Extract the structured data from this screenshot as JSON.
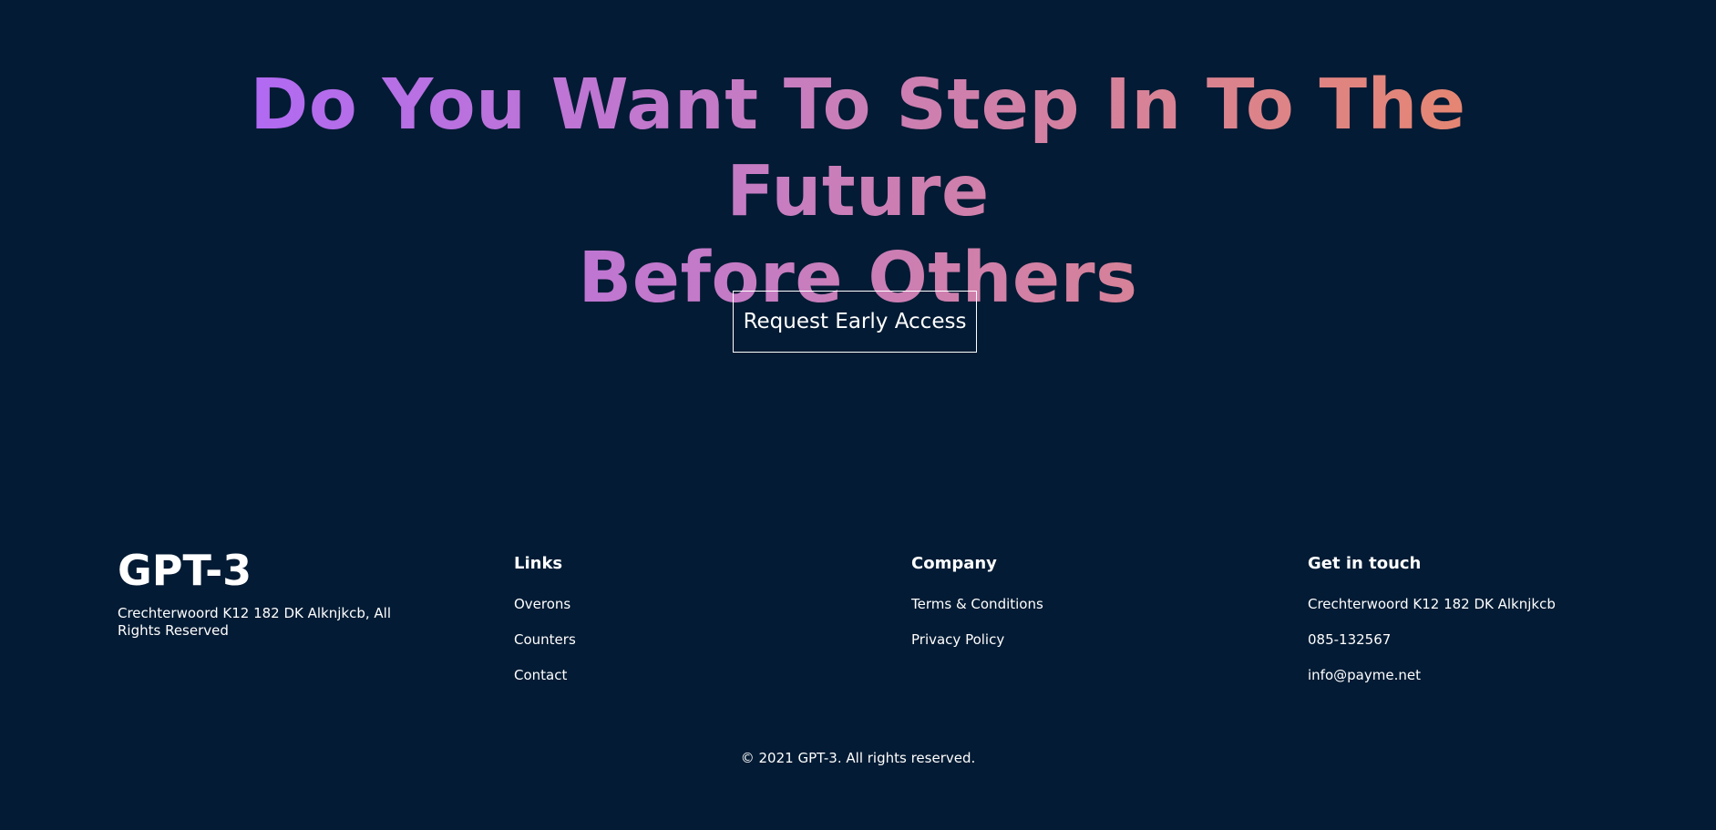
{
  "hero": {
    "heading_line1": "Do You Want To Step In To The Future",
    "heading_line2": "Before Others",
    "cta_label": "Request Early Access",
    "gradient_colors": [
      "#AE67FA",
      "#E9876A"
    ]
  },
  "footer": {
    "logo": "GPT-3",
    "address": "Crechterwoord K12 182 DK Alknjkcb, All Rights Reserved",
    "columns": [
      {
        "title": "Links",
        "items": [
          "Overons",
          "Counters",
          "Contact"
        ]
      },
      {
        "title": "Company",
        "items": [
          "Terms & Conditions",
          "Privacy Policy"
        ]
      },
      {
        "title": "Get in touch",
        "items": [
          "Crechterwoord K12 182 DK Alknjkcb",
          "085-132567",
          "info@payme.net"
        ]
      }
    ],
    "copyright": "© 2021 GPT-3. All rights reserved."
  },
  "colors": {
    "background": "#031B34",
    "text": "#FFFFFF"
  }
}
